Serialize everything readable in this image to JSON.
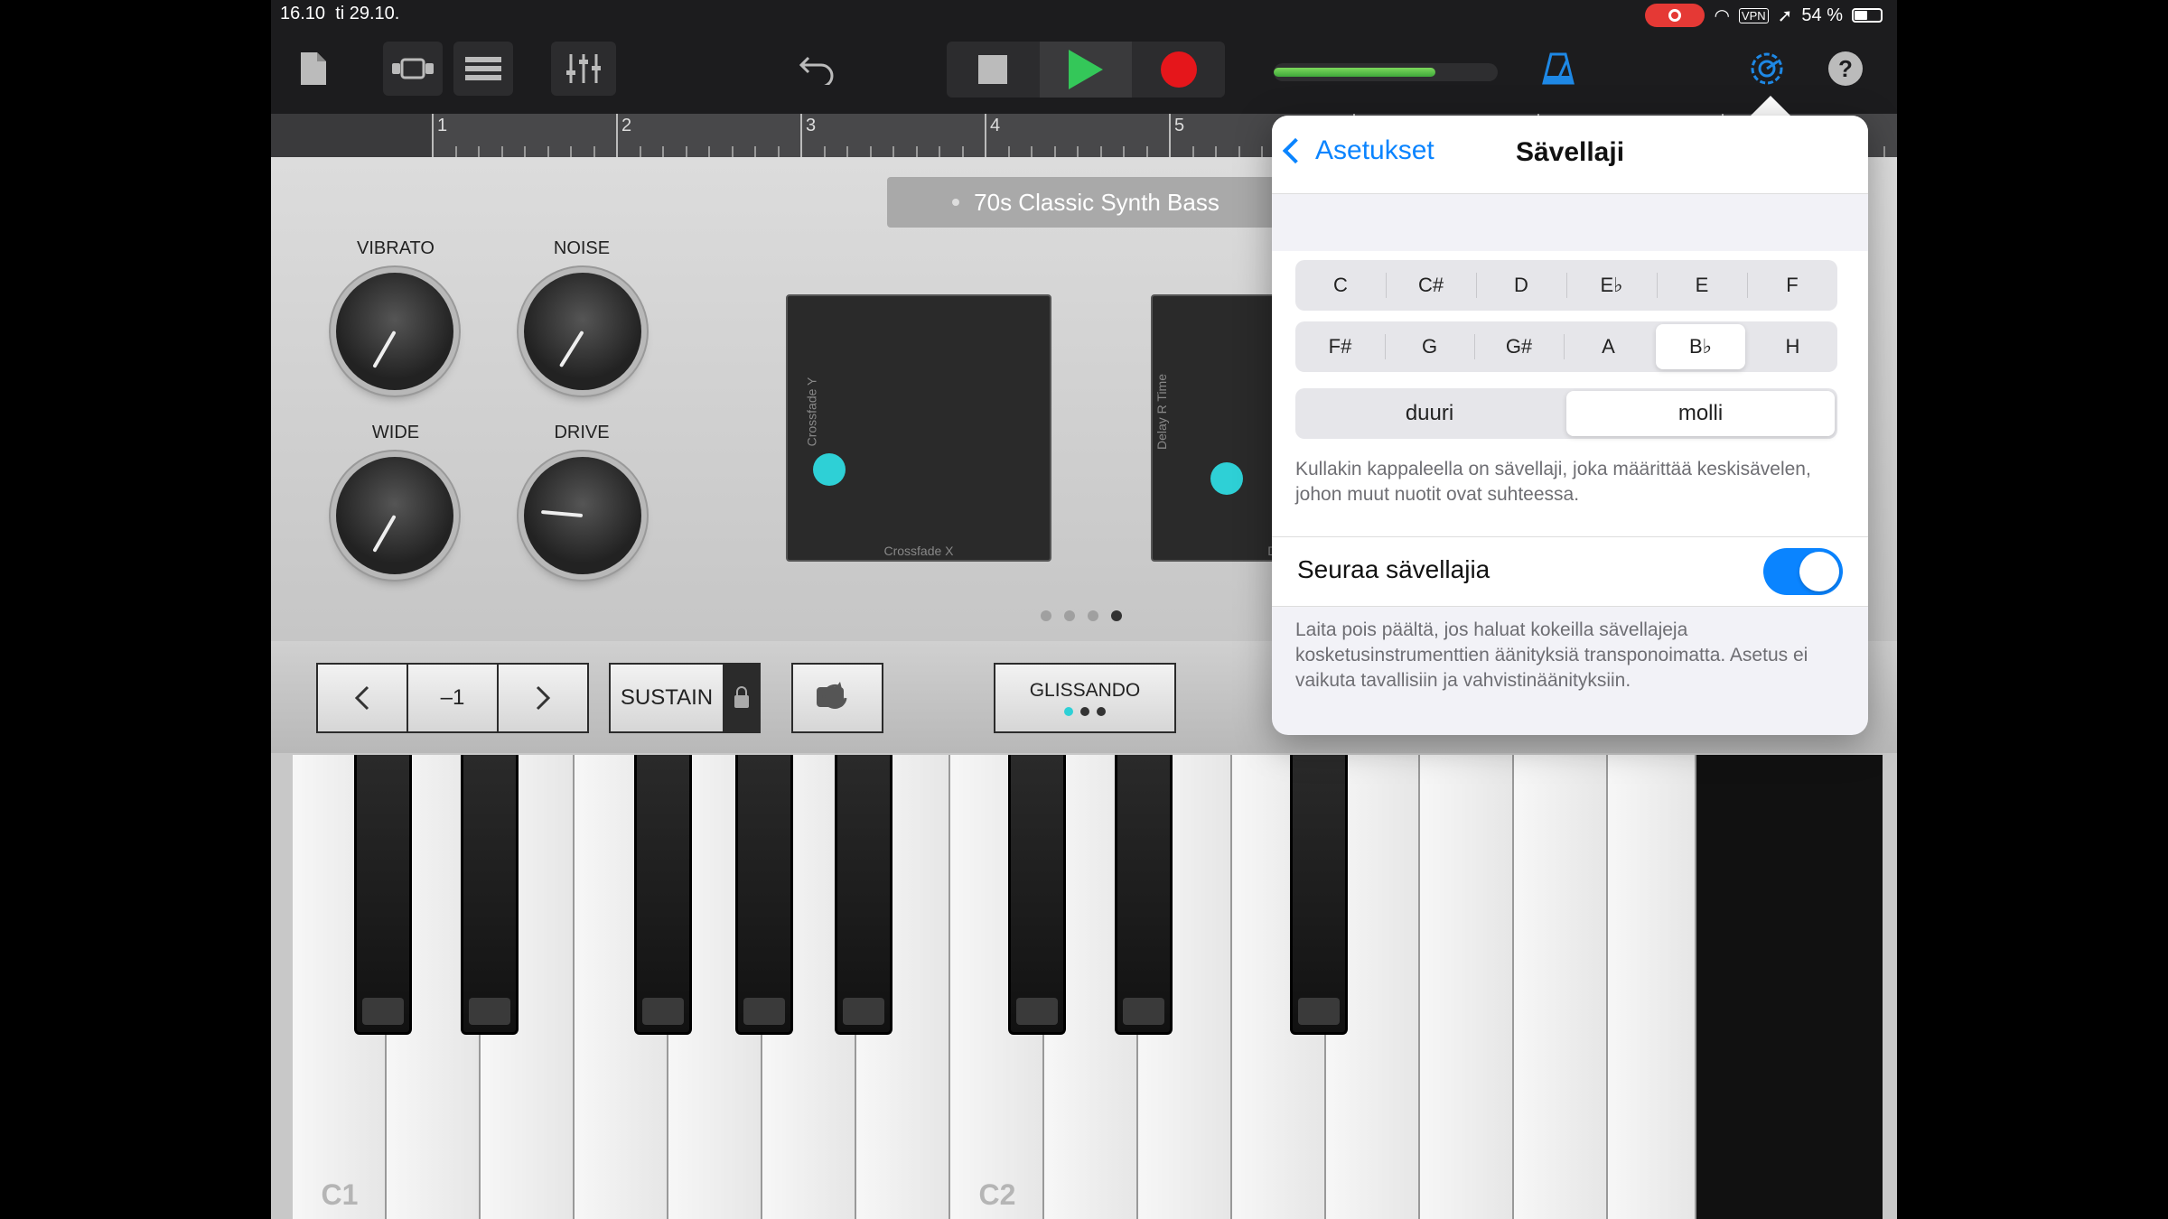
{
  "status": {
    "time": "16.10",
    "date": "ti 29.10.",
    "vpn": "VPN",
    "battery": "54 %"
  },
  "toolbar": {
    "volume_level": 0.72
  },
  "ruler": {
    "bars": [
      "1",
      "2",
      "3",
      "4",
      "5"
    ]
  },
  "synth": {
    "preset": "70s Classic Synth Bass",
    "knobs": {
      "vibrato": "VIBRATO",
      "noise": "NOISE",
      "wide": "WIDE",
      "drive": "DRIVE"
    },
    "pad1": {
      "y_label": "Crossfade Y",
      "x_label": "Crossfade X"
    },
    "pad2": {
      "y_label": "Delay R Time",
      "x_label": "Dela"
    }
  },
  "controls": {
    "octave": "–1",
    "sustain": "SUSTAIN",
    "glissando": "GLISSANDO"
  },
  "keyboard": {
    "c1": "C1",
    "c2": "C2"
  },
  "popover": {
    "back": "Asetukset",
    "title": "Sävellaji",
    "keys_row1": [
      "C",
      "C#",
      "D",
      "E♭",
      "E",
      "F"
    ],
    "keys_row2": [
      "F#",
      "G",
      "G#",
      "A",
      "B♭",
      "H"
    ],
    "selected_key": "B♭",
    "mode_major": "duuri",
    "mode_minor": "molli",
    "selected_mode": "molli",
    "key_desc": "Kullakin kappaleella on sävellaji, joka määrittää keskisävelen, johon muut nuotit ovat suhteessa.",
    "follow_label": "Seuraa sävellajia",
    "follow_on": true,
    "follow_desc": "Laita pois päältä, jos haluat kokeilla sävellajeja kosketusinstrumenttien äänityksiä transponoimatta. Asetus ei vaikuta tavallisiin ja vahvistinäänityksiin."
  },
  "colors": {
    "accent": "#0a84ff",
    "play": "#34c759",
    "record": "#e5161b",
    "pad_dot": "#2ed0d6"
  }
}
